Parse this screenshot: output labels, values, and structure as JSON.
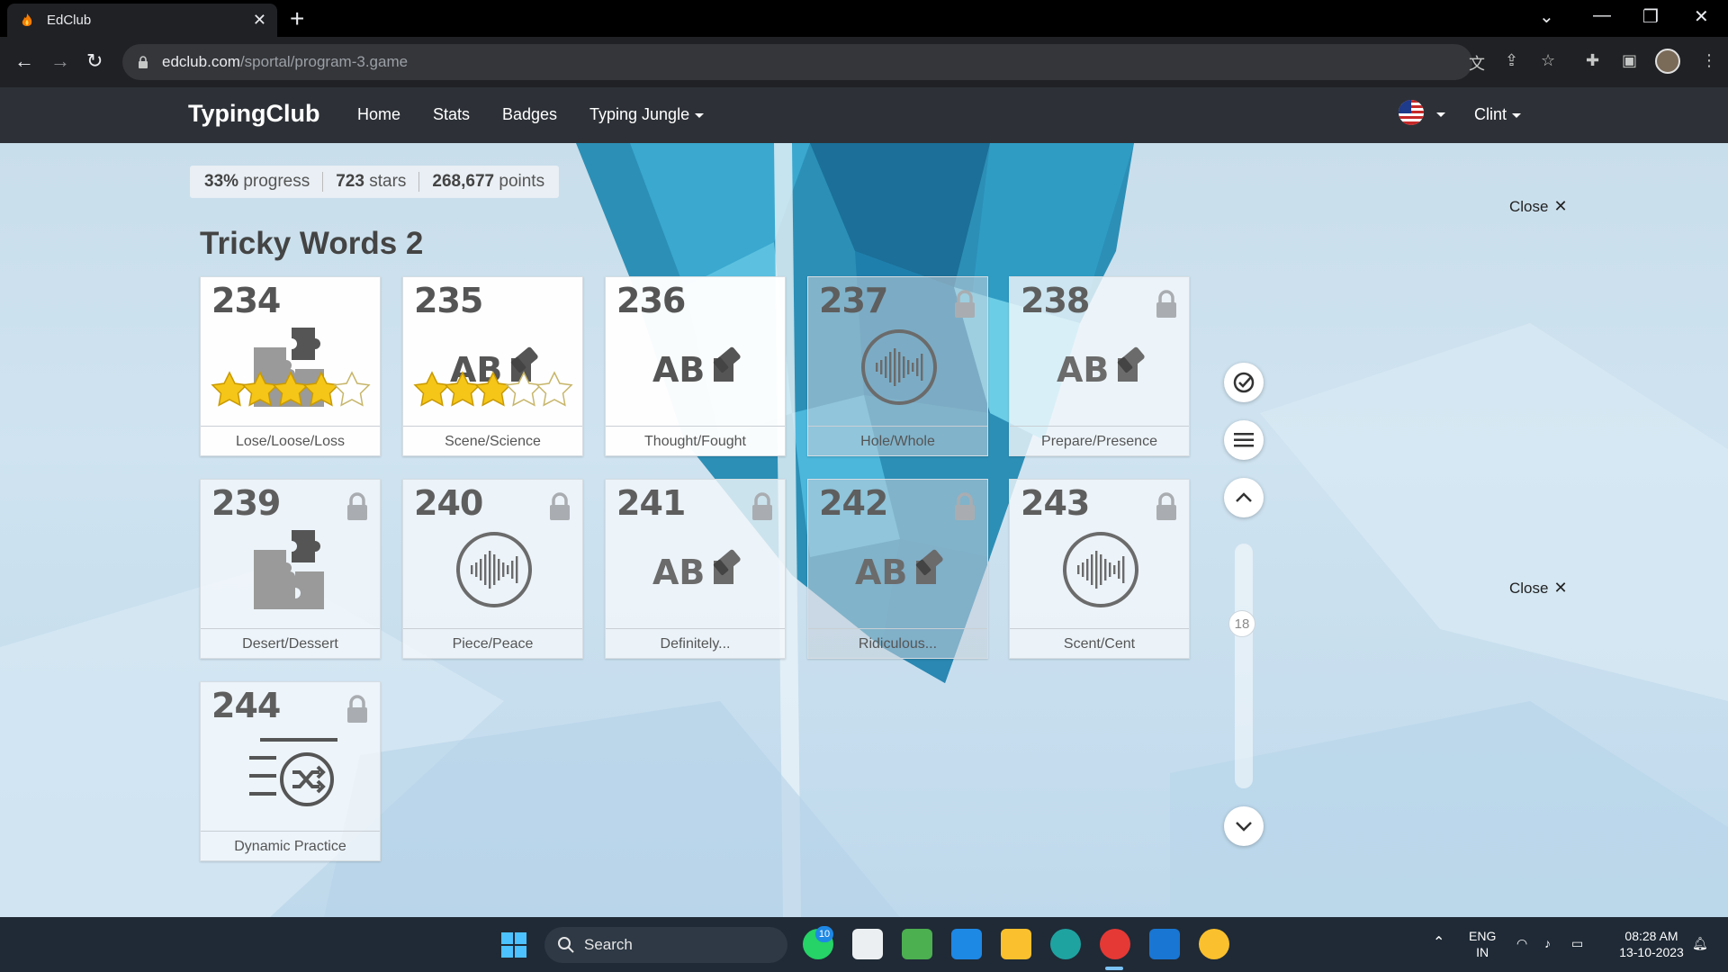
{
  "browser": {
    "tab_title": "EdClub",
    "url_host": "edclub.com",
    "url_path": "/sportal/program-3.game"
  },
  "site": {
    "brand": "TypingClub",
    "nav": [
      "Home",
      "Stats",
      "Badges",
      "Typing Jungle"
    ],
    "user": "Clint"
  },
  "progress": {
    "percent": "33%",
    "percent_label": "progress",
    "stars": "723",
    "stars_label": "stars",
    "points": "268,677",
    "points_label": "points"
  },
  "section_title": "Tricky Words 2",
  "close_label": "Close",
  "lessons": [
    {
      "num": "234",
      "label": "Lose/Loose/Loss",
      "icon": "puzzle-icon",
      "locked": false,
      "stars": 4
    },
    {
      "num": "235",
      "label": "Scene/Science",
      "icon": "abc-eraser-icon",
      "locked": false,
      "stars": 3
    },
    {
      "num": "236",
      "label": "Thought/Fought",
      "icon": "abc-eraser-icon",
      "locked": false,
      "stars": 0
    },
    {
      "num": "237",
      "label": "Hole/Whole",
      "icon": "audio-icon",
      "locked": true,
      "stars": 0
    },
    {
      "num": "238",
      "label": "Prepare/Presence",
      "icon": "abc-eraser-icon",
      "locked": true,
      "stars": 0
    },
    {
      "num": "239",
      "label": "Desert/Dessert",
      "icon": "puzzle-icon",
      "locked": true,
      "stars": 0
    },
    {
      "num": "240",
      "label": "Piece/Peace",
      "icon": "audio-icon",
      "locked": true,
      "stars": 0
    },
    {
      "num": "241",
      "label": "Definitely...",
      "icon": "abc-eraser-icon",
      "locked": true,
      "stars": 0
    },
    {
      "num": "242",
      "label": "Ridiculous...",
      "icon": "abc-eraser-icon",
      "locked": true,
      "stars": 0
    },
    {
      "num": "243",
      "label": "Scent/Cent",
      "icon": "audio-icon",
      "locked": true,
      "stars": 0
    },
    {
      "num": "244",
      "label": "Dynamic Practice",
      "icon": "dynamic-practice-icon",
      "locked": true,
      "stars": 0
    }
  ],
  "scroll_position": "18",
  "taskbar": {
    "search_label": "Search",
    "whatsapp_badge": "10",
    "lang_top": "ENG",
    "lang_bottom": "IN",
    "time": "08:28 AM",
    "date": "13-10-2023"
  },
  "colors": {
    "nav_bg": "#2d3137",
    "star": "#f5c518",
    "taskbar": "#1f2a36"
  }
}
